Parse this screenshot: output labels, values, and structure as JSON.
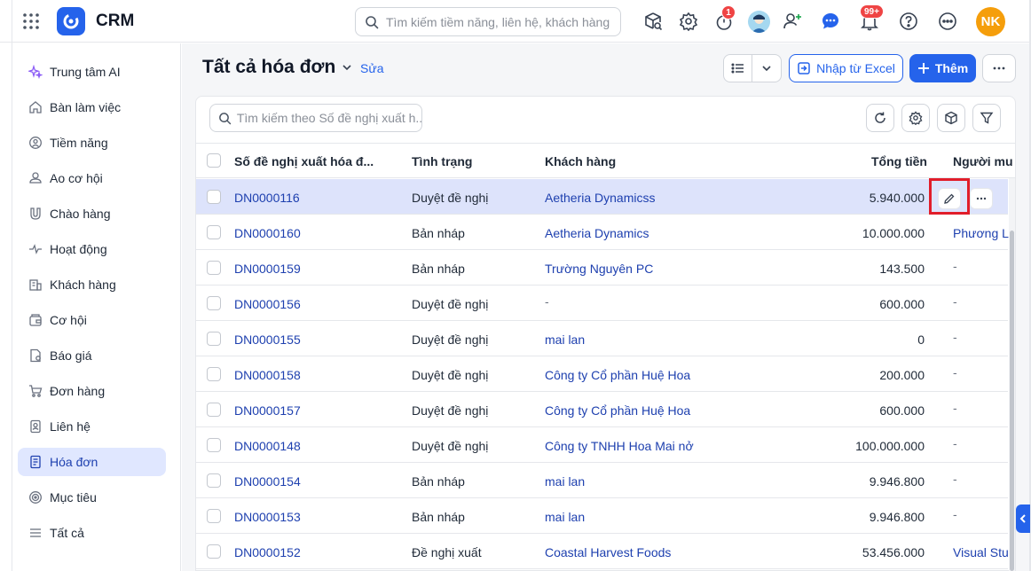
{
  "app": {
    "title": "CRM"
  },
  "topbar": {
    "search_placeholder": "Tìm kiếm tiềm năng, liên hệ, khách hàng",
    "timer_badge": "1",
    "notif_badge": "99+",
    "user_initials": "NK"
  },
  "sidebar": {
    "items": [
      {
        "label": "Trung tâm AI",
        "icon": "sparkle-icon"
      },
      {
        "label": "Bàn làm việc",
        "icon": "home-icon"
      },
      {
        "label": "Tiềm năng",
        "icon": "lead-icon"
      },
      {
        "label": "Ao cơ hội",
        "icon": "pool-icon"
      },
      {
        "label": "Chào hàng",
        "icon": "magnet-icon"
      },
      {
        "label": "Hoạt động",
        "icon": "activity-icon"
      },
      {
        "label": "Khách hàng",
        "icon": "building-icon"
      },
      {
        "label": "Cơ hội",
        "icon": "wallet-icon"
      },
      {
        "label": "Báo giá",
        "icon": "quote-icon"
      },
      {
        "label": "Đơn hàng",
        "icon": "cart-icon"
      },
      {
        "label": "Liên hệ",
        "icon": "contact-icon"
      },
      {
        "label": "Hóa đơn",
        "icon": "invoice-icon",
        "active": true
      },
      {
        "label": "Mục tiêu",
        "icon": "target-icon"
      },
      {
        "label": "Tất cả",
        "icon": "menu-icon"
      }
    ]
  },
  "page": {
    "title": "Tất cả hóa đơn",
    "edit_link": "Sửa",
    "import_label": "Nhập từ Excel",
    "add_label": "Thêm"
  },
  "table": {
    "search_placeholder": "Tìm kiếm theo Số đề nghị xuất h...",
    "columns": {
      "number": "Số đề nghị xuất hóa đ...",
      "status": "Tình trạng",
      "customer": "Khách hàng",
      "total": "Tổng tiền",
      "buyer": "Người mu"
    },
    "rows": [
      {
        "number": "DN0000116",
        "status": "Duyệt đề nghị",
        "customer": "Aetheria Dynamicss",
        "total": "5.940.000",
        "buyer": ""
      },
      {
        "number": "DN0000160",
        "status": "Bản nháp",
        "customer": "Aetheria Dynamics",
        "total": "10.000.000",
        "buyer": "Phương Li"
      },
      {
        "number": "DN0000159",
        "status": "Bản nháp",
        "customer": "Trường Nguyên PC",
        "total": "143.500",
        "buyer": "-"
      },
      {
        "number": "DN0000156",
        "status": "Duyệt đề nghị",
        "customer": "-",
        "total": "600.000",
        "buyer": "-"
      },
      {
        "number": "DN0000155",
        "status": "Duyệt đề nghị",
        "customer": "mai lan",
        "total": "0",
        "buyer": "-"
      },
      {
        "number": "DN0000158",
        "status": "Duyệt đề nghị",
        "customer": "Công ty Cổ phần Huệ Hoa",
        "total": "200.000",
        "buyer": "-"
      },
      {
        "number": "DN0000157",
        "status": "Duyệt đề nghị",
        "customer": "Công ty Cổ phần Huệ Hoa",
        "total": "600.000",
        "buyer": "-"
      },
      {
        "number": "DN0000148",
        "status": "Duyệt đề nghị",
        "customer": "Công ty TNHH Hoa Mai nở",
        "total": "100.000.000",
        "buyer": "-"
      },
      {
        "number": "DN0000154",
        "status": "Bản nháp",
        "customer": "mai lan",
        "total": "9.946.800",
        "buyer": "-"
      },
      {
        "number": "DN0000153",
        "status": "Bản nháp",
        "customer": "mai lan",
        "total": "9.946.800",
        "buyer": "-"
      },
      {
        "number": "DN0000152",
        "status": "Đề nghị xuất",
        "customer": "Coastal Harvest Foods",
        "total": "53.456.000",
        "buyer": "Visual Stu"
      }
    ]
  },
  "colors": {
    "primary": "#2563eb",
    "link": "#1e40af",
    "selected_row": "#dde3fb",
    "highlight_border": "#e11d2a"
  }
}
